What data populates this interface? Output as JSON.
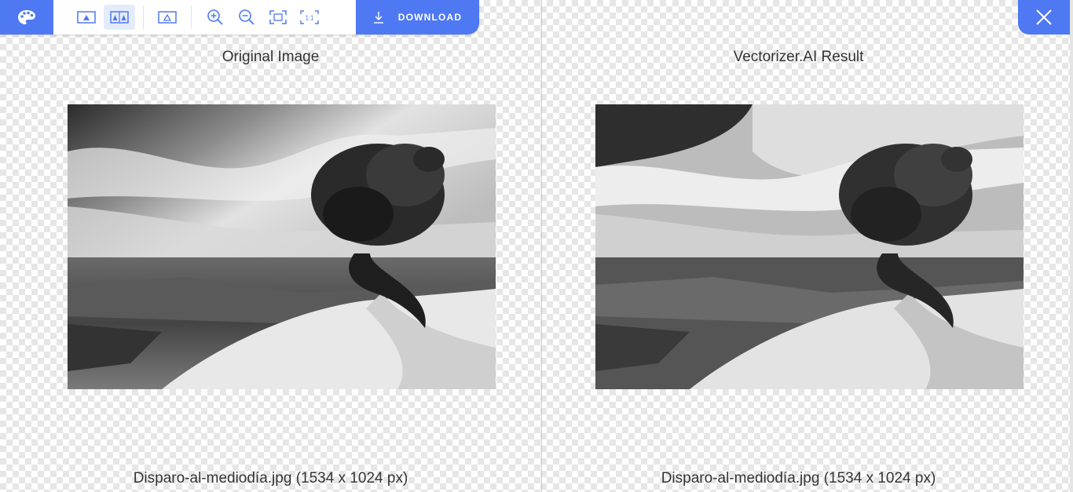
{
  "toolbar": {
    "download_label": "DOWNLOAD",
    "icons": [
      "palette-icon",
      "single-view-icon",
      "side-by-side-icon",
      "overlay-icon",
      "zoom-in-icon",
      "zoom-out-icon",
      "fit-screen-icon",
      "actual-size-icon",
      "download-icon"
    ],
    "accent_color": "#4f79f3"
  },
  "panels": {
    "left": {
      "title": "Original Image",
      "caption": "Disparo-al-mediodía.jpg (1534 x 1024 px)"
    },
    "right": {
      "title": "Vectorizer.AI Result",
      "caption": "Disparo-al-mediodía.jpg (1534 x 1024 px)"
    }
  },
  "close_icon": "close-icon"
}
